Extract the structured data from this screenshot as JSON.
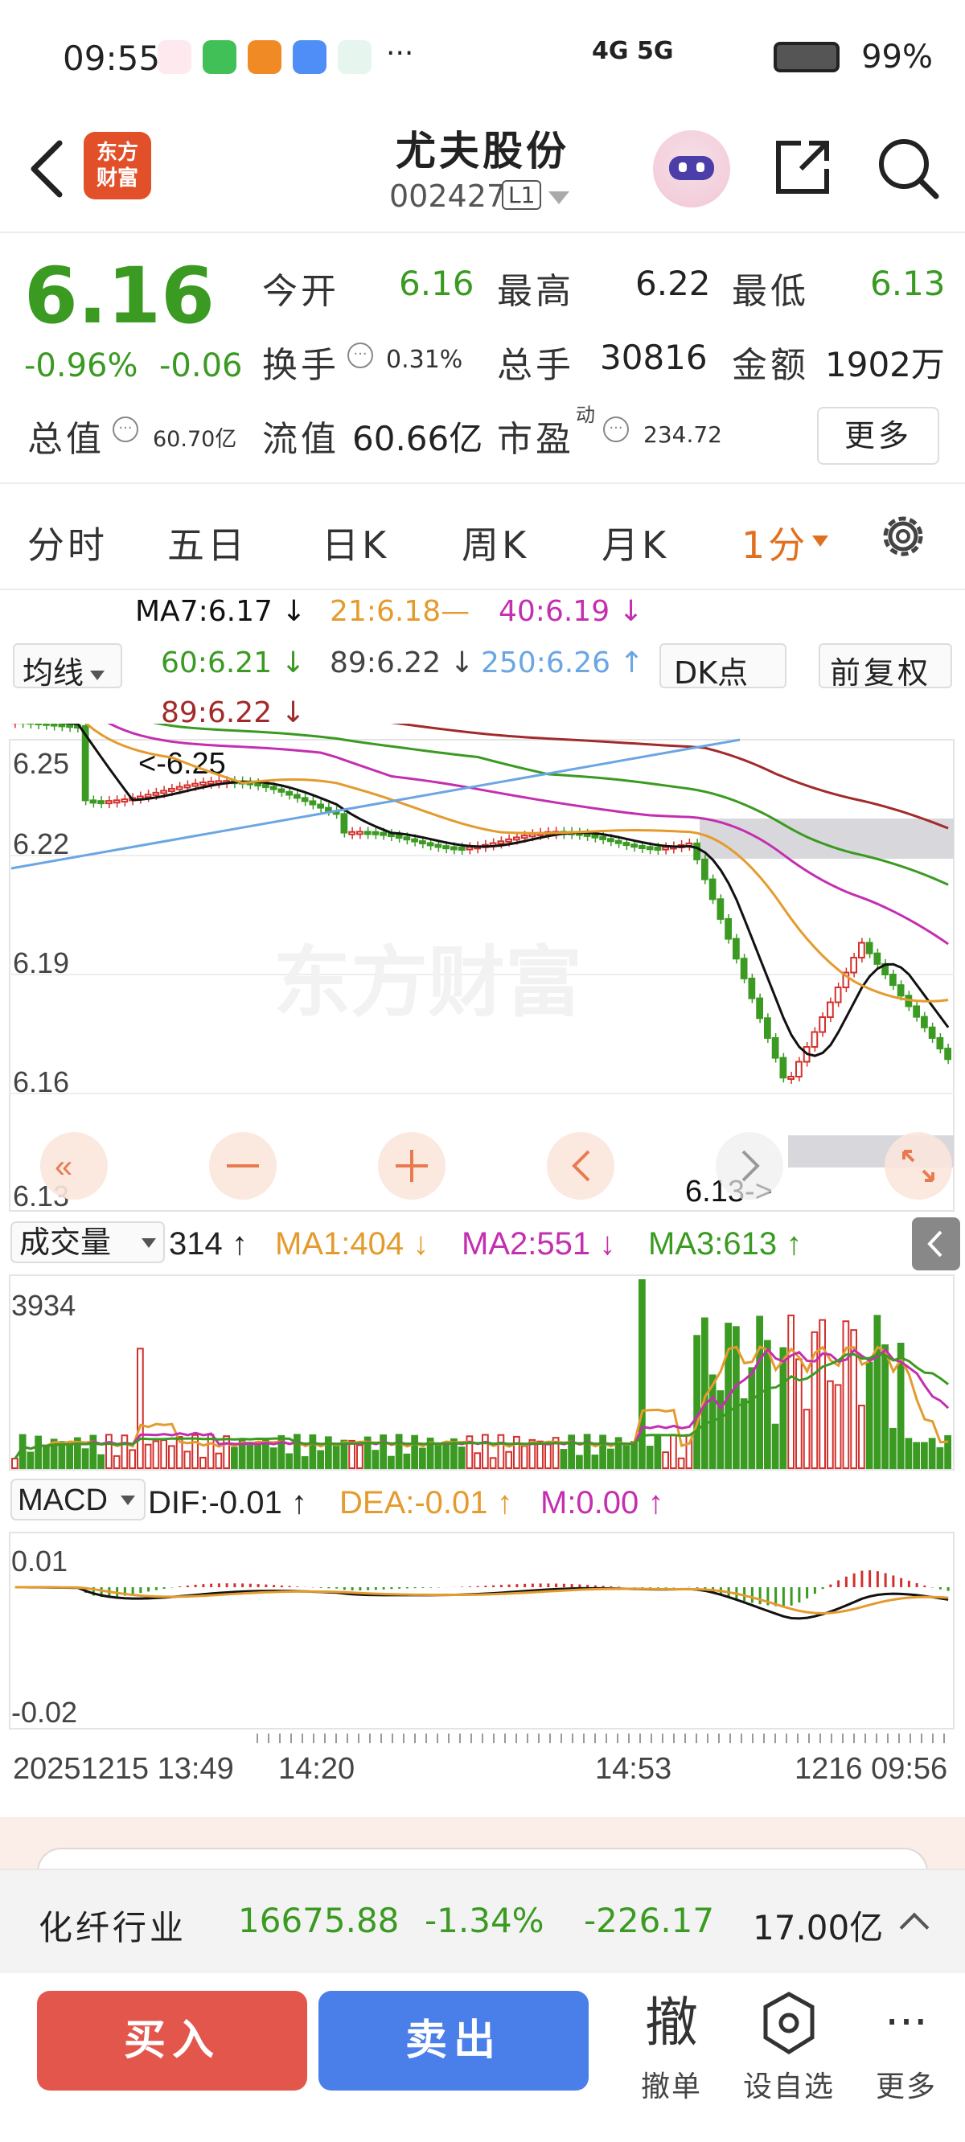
{
  "status_bar": {
    "time": "09:55",
    "more": "···",
    "signal_text": "4G 5G",
    "battery": "99%"
  },
  "header": {
    "logo_line1": "东方",
    "logo_line2": "财富",
    "stock_name": "尤夫股份",
    "stock_code": "002427",
    "level": "L1"
  },
  "quote": {
    "price": "6.16",
    "pct_change": "-0.96%",
    "change": "-0.06",
    "labels": {
      "open": "今开",
      "high": "最高",
      "low": "最低",
      "turnover": "换手",
      "volume": "总手",
      "amount": "金额",
      "total_value": "总值",
      "float_value": "流值",
      "pe": "市盈",
      "pe_sup": "动"
    },
    "open": "6.16",
    "high": "6.22",
    "low": "6.13",
    "turnover": "0.31%",
    "volume": "30816",
    "amount": "1902万",
    "total_value": "60.70亿",
    "float_value": "60.66亿",
    "pe": "234.72",
    "more_button": "更多"
  },
  "tabs": [
    "分时",
    "五日",
    "日K",
    "周K",
    "月K",
    "1分"
  ],
  "ma_legend": {
    "ma7": "MA7:6.17 ↓",
    "ma21": "21:6.18—",
    "ma40": "40:6.19 ↓",
    "ma60": "60:6.21 ↓",
    "ma89a": "89:6.22 ↓",
    "ma250": "250:6.26 ↑",
    "ma89b": "89:6.22 ↓",
    "ma_dropdown": "均线",
    "dk_button": "DK点",
    "fuquan_button": "前复权"
  },
  "main_chart": {
    "y_labels": [
      "6.25",
      "6.22",
      "6.19",
      "6.16",
      "6.13"
    ],
    "high_marker": "<-6.25",
    "low_marker": "6.13->",
    "watermark": "东方财富"
  },
  "volume_panel": {
    "dropdown": "成交量",
    "current": "314 ↑",
    "ma1": "MA1:404 ↓",
    "ma2": "MA2:551 ↓",
    "ma3": "MA3:613 ↑",
    "y_max": "3934"
  },
  "macd_panel": {
    "dropdown": "MACD",
    "dif": "DIF:-0.01 ↑",
    "dea": "DEA:-0.01 ↑",
    "m": "M:0.00 ↑",
    "y_top": "0.01",
    "y_bottom": "-0.02"
  },
  "time_axis": [
    "20251215 13:49",
    "14:20",
    "14:53",
    "1216 09:56"
  ],
  "sector": {
    "name": "化纤行业",
    "index": "16675.88",
    "pct": "-1.34%",
    "change": "-226.17",
    "amount": "17.00亿"
  },
  "actions": {
    "buy": "买入",
    "sell": "卖出",
    "cancel_icon": "撤",
    "cancel": "撤单",
    "watch": "设自选",
    "more_icon": "···",
    "more": "更多"
  },
  "colors": {
    "up": "#d2302c",
    "down": "#3a9a22",
    "accent": "#e07020",
    "ma7": "#111111",
    "ma21": "#e49b2e",
    "ma40": "#c42fb0",
    "ma60": "#3a9a22",
    "ma89": "#a32a2a",
    "ma250": "#6aa6e2",
    "buy": "#e2564c",
    "sell": "#4a7ee8"
  }
}
